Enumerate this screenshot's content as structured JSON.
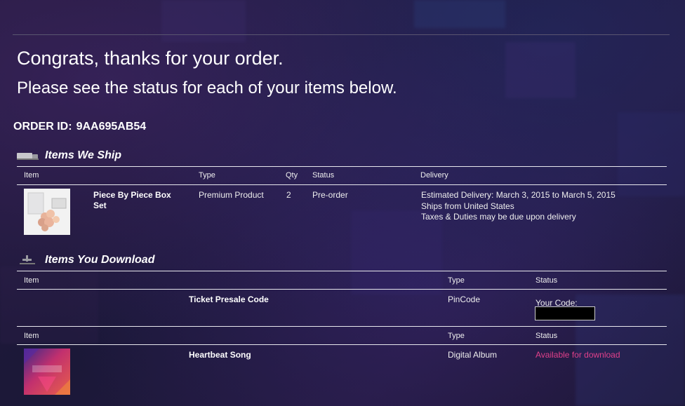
{
  "page": {
    "heading": "Congrats, thanks for your order.",
    "subheading": "Please see the status for each of your items below.",
    "order_id_label": "ORDER ID:",
    "order_id_value": "9AA695AB54"
  },
  "ship_section": {
    "title": "Items We Ship",
    "icon": "truck-icon",
    "columns": {
      "item": "Item",
      "type": "Type",
      "qty": "Qty",
      "status": "Status",
      "delivery": "Delivery"
    },
    "rows": [
      {
        "name": "Piece By Piece Box Set",
        "type": "Premium Product",
        "qty": "2",
        "status": "Pre-order",
        "delivery": [
          "Estimated Delivery: March 3, 2015 to March 5, 2015",
          "Ships from United States",
          "Taxes & Duties may be due upon delivery"
        ]
      }
    ]
  },
  "download_section": {
    "title": "Items You Download",
    "icon": "download-icon",
    "groups": [
      {
        "columns": {
          "item": "Item",
          "type": "Type",
          "status": "Status"
        },
        "name": "Ticket Presale Code",
        "type": "PinCode",
        "status_label": "Your Code:",
        "code_value": ""
      },
      {
        "columns": {
          "item": "Item",
          "type": "Type",
          "status": "Status"
        },
        "name": "Heartbeat Song",
        "type": "Digital Album",
        "status": "Available for download",
        "status_color": "#e0408a"
      }
    ]
  }
}
